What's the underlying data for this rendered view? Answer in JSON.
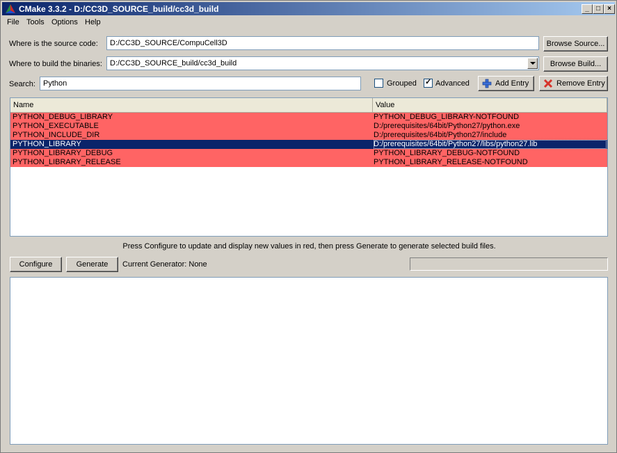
{
  "window": {
    "title": "CMake 3.3.2 - D:/CC3D_SOURCE_build/cc3d_build",
    "minimize_glyph": "_",
    "maximize_glyph": "□",
    "close_glyph": "×"
  },
  "menu": [
    "File",
    "Tools",
    "Options",
    "Help"
  ],
  "source": {
    "label": "Where is the source code:",
    "value": "D:/CC3D_SOURCE/CompuCell3D",
    "browse_label": "Browse Source..."
  },
  "build": {
    "label": "Where to build the binaries:",
    "value": "D:/CC3D_SOURCE_build/cc3d_build",
    "browse_label": "Browse Build..."
  },
  "search": {
    "label": "Search:",
    "value": "Python"
  },
  "options": {
    "grouped_label": "Grouped",
    "grouped_checked": false,
    "advanced_label": "Advanced",
    "advanced_checked": true,
    "check_glyph": "✓"
  },
  "actions": {
    "add_label": "Add Entry",
    "remove_label": "Remove Entry"
  },
  "table": {
    "columns": [
      "Name",
      "Value"
    ],
    "rows": [
      {
        "name": "PYTHON_DEBUG_LIBRARY",
        "value": "PYTHON_DEBUG_LIBRARY-NOTFOUND",
        "selected": false
      },
      {
        "name": "PYTHON_EXECUTABLE",
        "value": "D:/prerequisites/64bit/Python27/python.exe",
        "selected": false
      },
      {
        "name": "PYTHON_INCLUDE_DIR",
        "value": "D:/prerequisites/64bit/Python27/include",
        "selected": false
      },
      {
        "name": "PYTHON_LIBRARY",
        "value": "D:/prerequisites/64bit/Python27/libs/python27.lib",
        "selected": true
      },
      {
        "name": "PYTHON_LIBRARY_DEBUG",
        "value": "PYTHON_LIBRARY_DEBUG-NOTFOUND",
        "selected": false
      },
      {
        "name": "PYTHON_LIBRARY_RELEASE",
        "value": "PYTHON_LIBRARY_RELEASE-NOTFOUND",
        "selected": false
      }
    ],
    "new_row_color": "#ff6464",
    "selected_row_color": "#0a246a"
  },
  "hint": "Press Configure to update and display new values in red, then press Generate to generate selected build files.",
  "bottom": {
    "configure_label": "Configure",
    "generate_label": "Generate",
    "generator_label": "Current Generator: None"
  },
  "colors": {
    "title_start": "#0a246a",
    "title_end": "#a6caf0",
    "face": "#d4d0c8"
  }
}
